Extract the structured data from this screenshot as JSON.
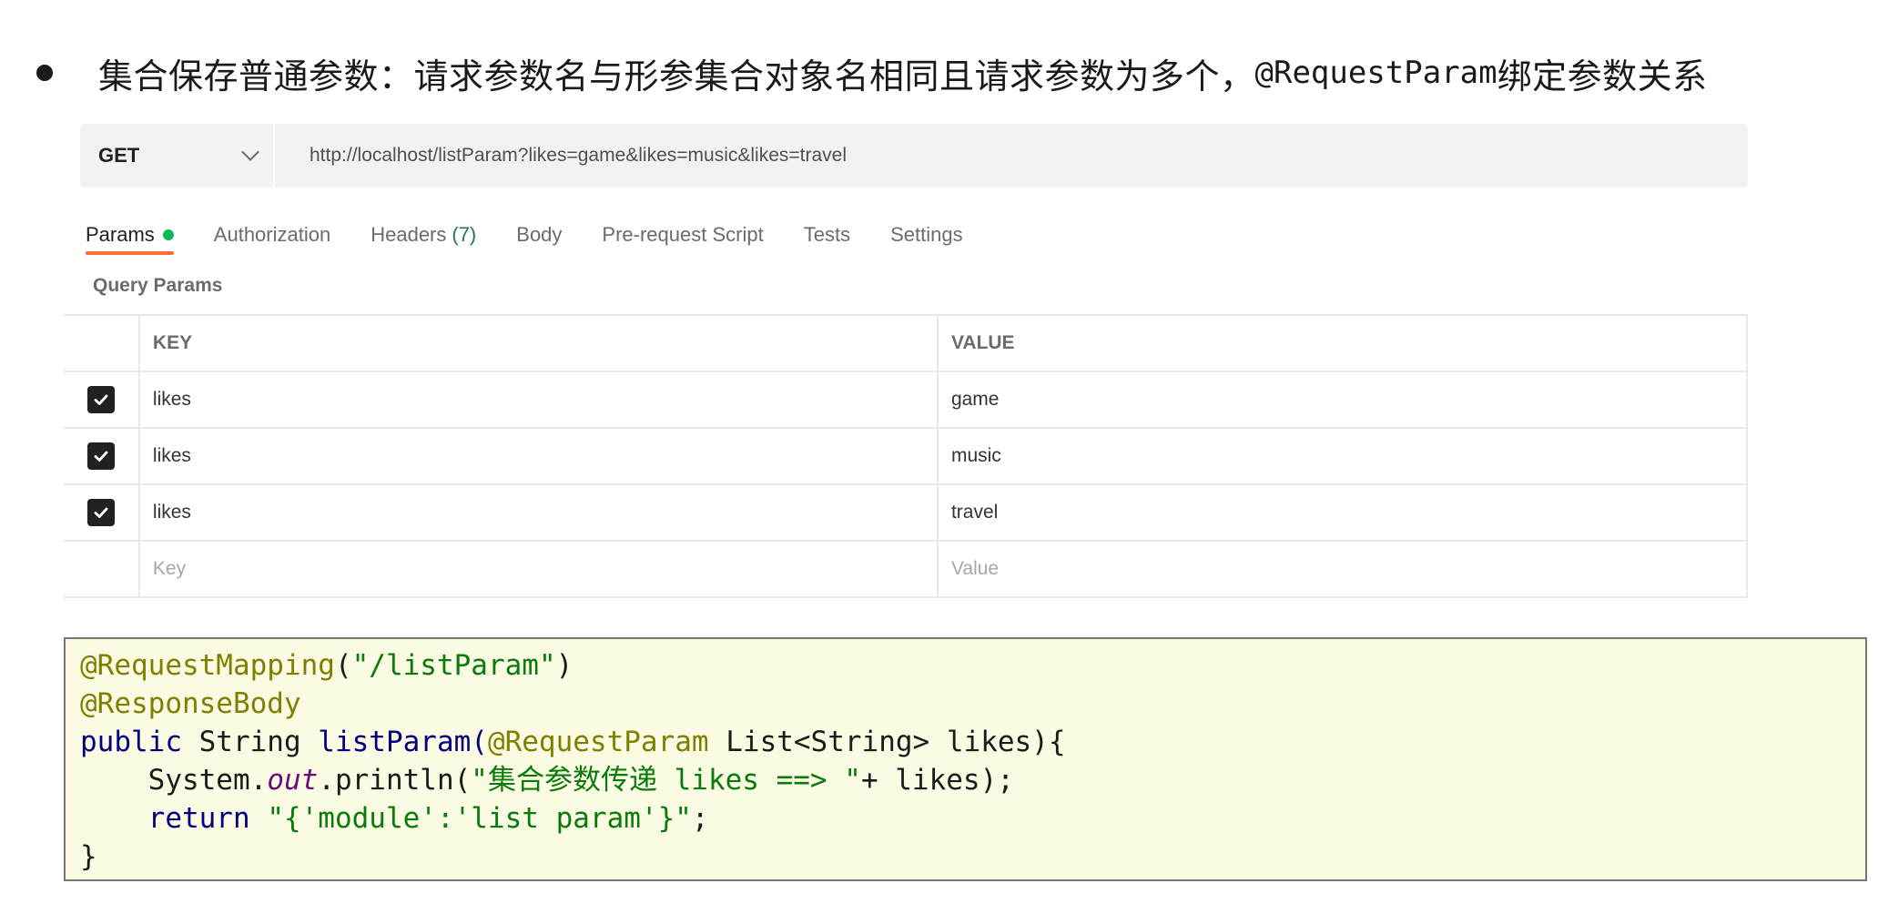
{
  "heading": {
    "text_cn": "集合保存普通参数：请求参数名与形参集合对象名相同且请求参数为多个，",
    "text_code": "@RequestParam",
    "text_tail": "绑定参数关系"
  },
  "request": {
    "method": "GET",
    "url": "http://localhost/listParam?likes=game&likes=music&likes=travel"
  },
  "tabs": [
    {
      "label": "Params",
      "active": true
    },
    {
      "label": "Authorization"
    },
    {
      "label": "Headers",
      "count": "(7)"
    },
    {
      "label": "Body"
    },
    {
      "label": "Pre-request Script"
    },
    {
      "label": "Tests"
    },
    {
      "label": "Settings"
    }
  ],
  "query_params": {
    "label": "Query Params",
    "columns": [
      "KEY",
      "VALUE"
    ],
    "rows": [
      {
        "key": "likes",
        "value": "game",
        "checked": true
      },
      {
        "key": "likes",
        "value": "music",
        "checked": true
      },
      {
        "key": "likes",
        "value": "travel",
        "checked": true
      }
    ],
    "placeholder_key": "Key",
    "placeholder_value": "Value"
  },
  "code": {
    "l1_anno": "@RequestMapping",
    "l1_open": "(",
    "l1_str": "\"/listParam\"",
    "l1_close": ")",
    "l2_anno": "@ResponseBody",
    "l3_kw": "public",
    "l3_a": " String ",
    "l3_method": "listParam(",
    "l3_anno": "@RequestParam",
    "l3_b": " List<String> likes){",
    "l4_a": "    System.",
    "l4_field": "out",
    "l4_b": ".println(",
    "l4_str": "\"集合参数传递 likes ==> \"",
    "l4_c": "+ likes);",
    "l5_kw": "    return",
    "l5_sp": " ",
    "l5_str": "\"{'module':'list param'}\"",
    "l5_end": ";",
    "l6": "}"
  },
  "colors": {
    "active_tab_underline": "#ff6c37",
    "params_dot": "#0cbb52",
    "code_bg": "#fbfbe4"
  }
}
